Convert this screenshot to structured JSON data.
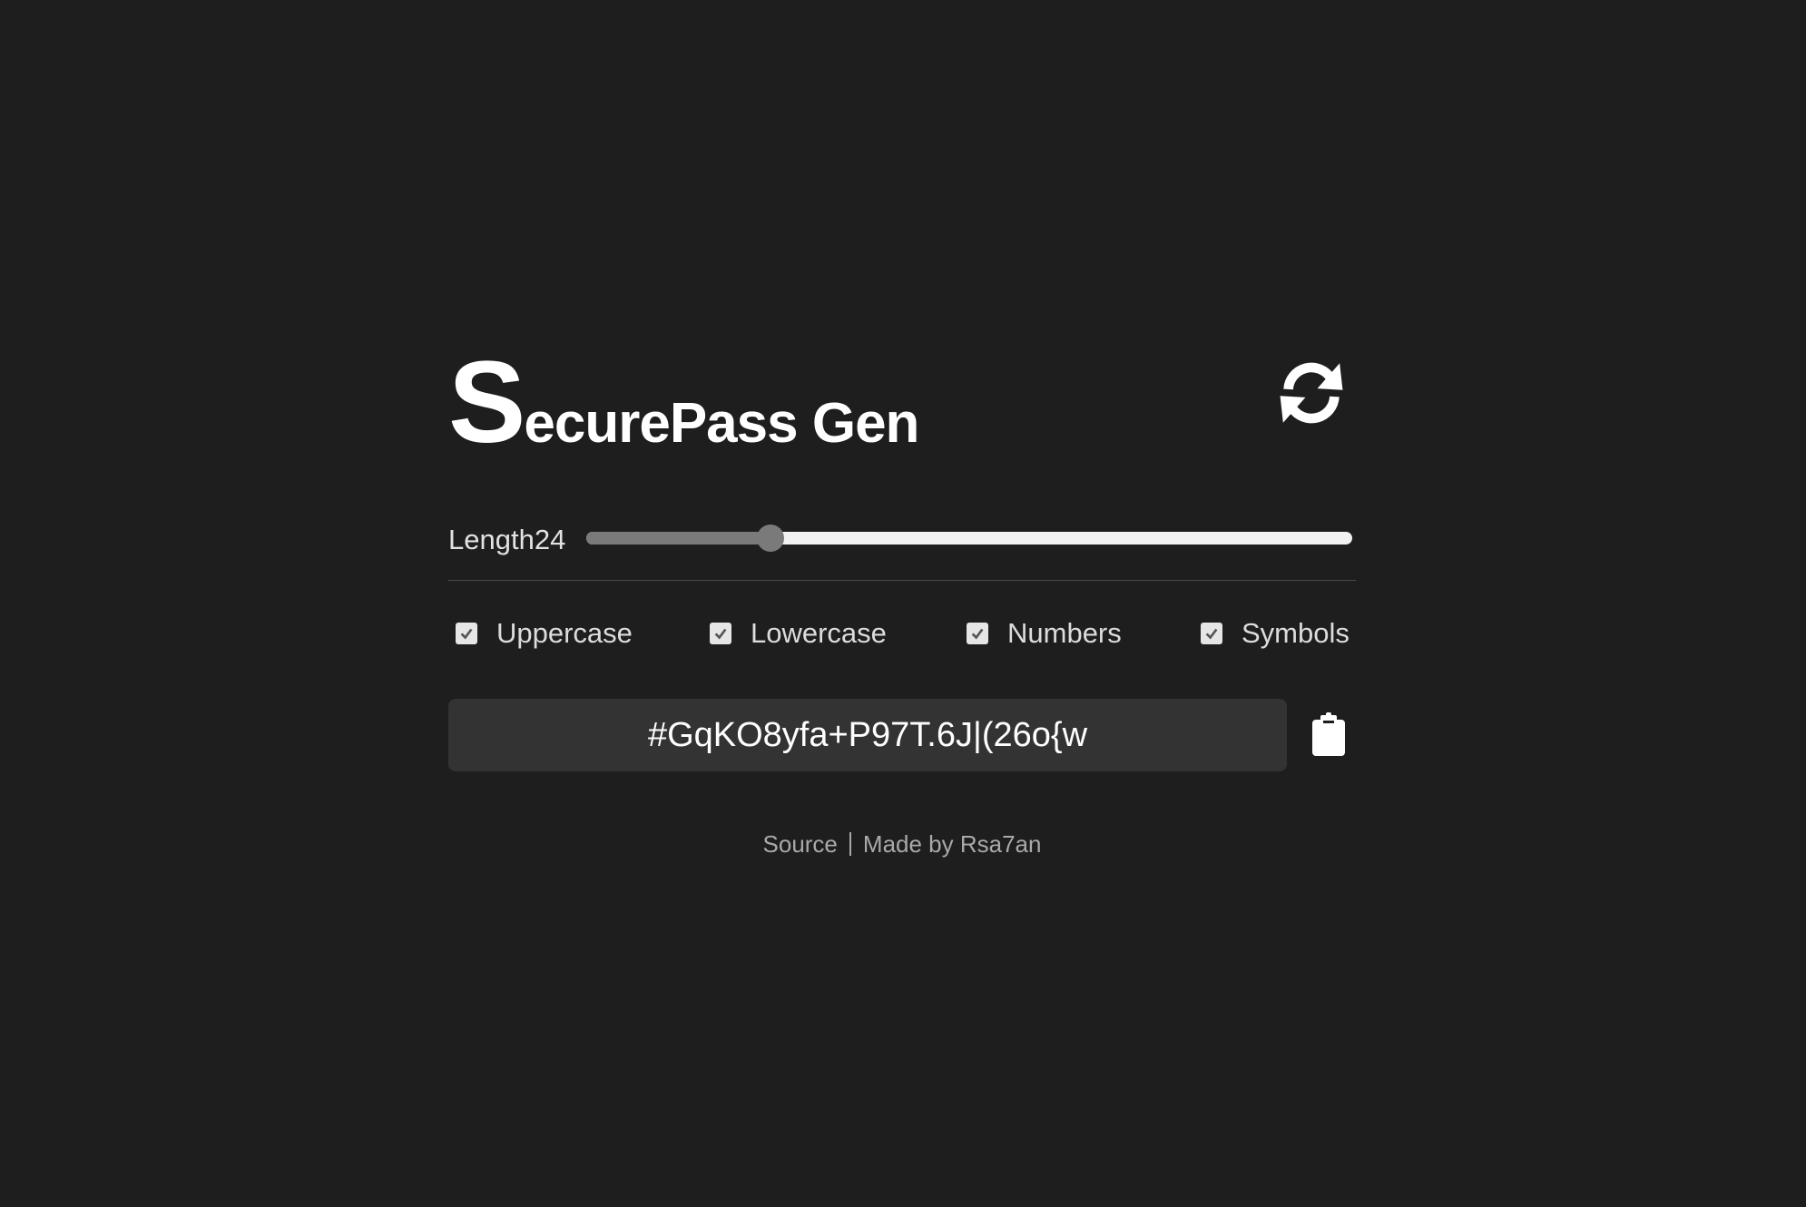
{
  "app": {
    "title_first_letter": "S",
    "title_rest": "ecurePass Gen"
  },
  "icons": {
    "refresh": "refresh-icon",
    "clipboard": "clipboard-icon",
    "checkmark": "checkmark-icon"
  },
  "length": {
    "label": "Length",
    "value": "24",
    "slider_fraction": 0.24
  },
  "options": [
    {
      "label": "Uppercase",
      "checked": true
    },
    {
      "label": "Lowercase",
      "checked": true
    },
    {
      "label": "Numbers",
      "checked": true
    },
    {
      "label": "Symbols",
      "checked": true
    }
  ],
  "password": "#GqKO8yfa+P97T.6J|(26o{w",
  "footer": {
    "source_link": "Source",
    "credit": "Made by Rsa7an"
  },
  "colors": {
    "background": "#1e1e1e",
    "panel": "#333333",
    "text": "#ffffff",
    "muted": "#a9a9a9",
    "slider_fill": "#7a7a7a",
    "slider_track": "#f2f2f2"
  }
}
